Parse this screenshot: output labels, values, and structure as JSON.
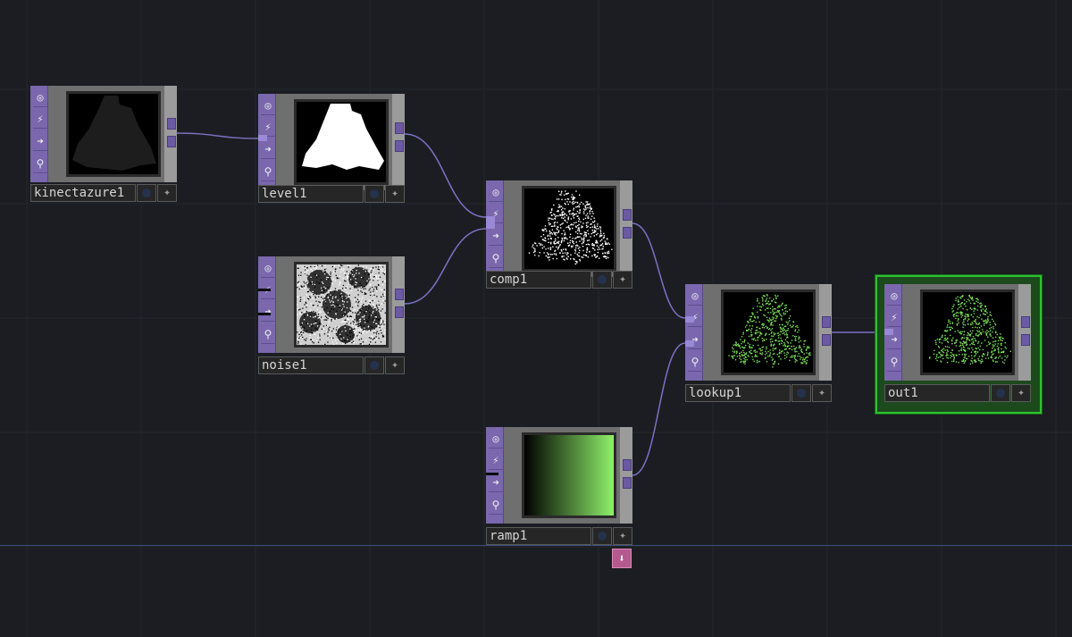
{
  "network": {
    "nodes": [
      {
        "id": "kinectazure1",
        "name": "kinectazure1",
        "preview": "dark-silhouette"
      },
      {
        "id": "level1",
        "name": "level1",
        "preview": "white-silhouette"
      },
      {
        "id": "noise1",
        "name": "noise1",
        "preview": "noise"
      },
      {
        "id": "comp1",
        "name": "comp1",
        "preview": "speckled-silhouette"
      },
      {
        "id": "ramp1",
        "name": "ramp1",
        "preview": "green-ramp"
      },
      {
        "id": "lookup1",
        "name": "lookup1",
        "preview": "green-speckle"
      },
      {
        "id": "out1",
        "name": "out1",
        "preview": "green-speckle",
        "selected": true
      }
    ],
    "strip_icons": [
      "bypass-icon",
      "lock-icon",
      "arrow-icon",
      "viewer-icon"
    ],
    "strip_glyphs": [
      "◎",
      "⚡",
      "➜",
      "⚲"
    ],
    "footer_star_glyph": "✦",
    "flag_glyph": "⬇"
  },
  "colors": {
    "background": "#1b1d22",
    "op_strip": "#7a67ad",
    "wire": "#7d70c4",
    "selected": "#2ec133",
    "ramp_start": "#000000",
    "ramp_end": "#8ef06a",
    "flag": "#b45a8f"
  }
}
